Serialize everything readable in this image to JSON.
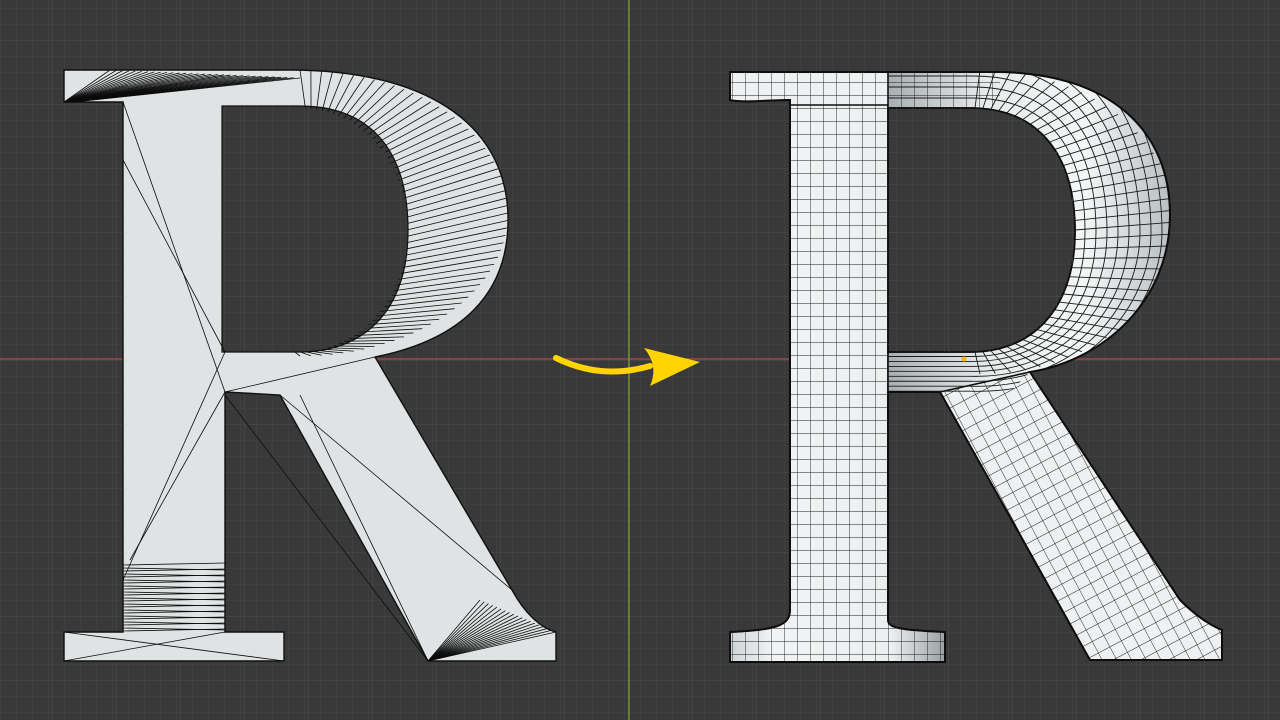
{
  "scene": {
    "background_color": "#393939",
    "grid_minor_color": "#444444",
    "grid_major_color": "#4e4e4e",
    "x_axis_color": "#b8474f",
    "y_axis_color": "#7fa52f",
    "mesh_fill_color": "#dfe3e4",
    "wire_color": "#0c0c0c",
    "arrow_color": "#ffd400"
  },
  "objects": [
    {
      "name": "Text",
      "glyph": "R",
      "topology": "triangulated-ngon"
    },
    {
      "name": "Text.001",
      "glyph": "R",
      "topology": "quad-remesh"
    }
  ]
}
